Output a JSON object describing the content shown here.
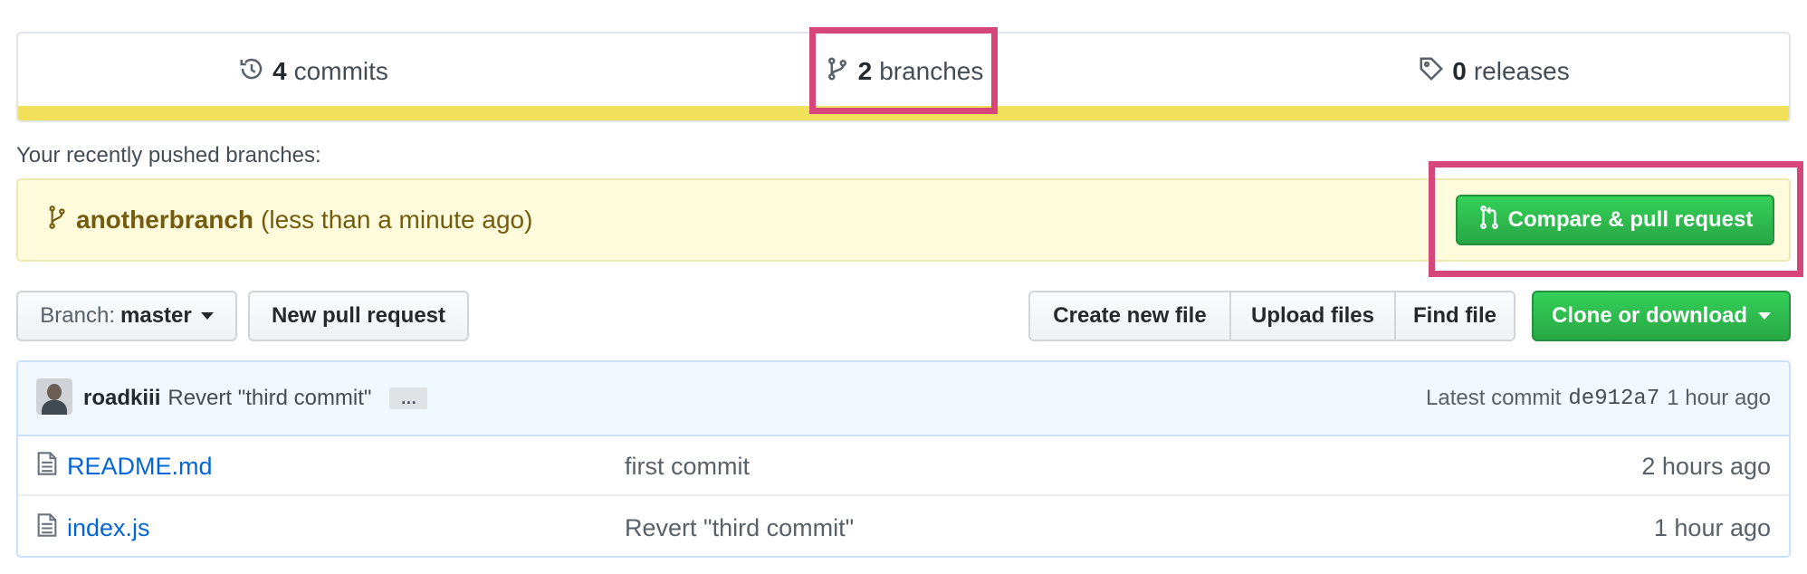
{
  "summary": {
    "commits": {
      "count": "4",
      "label": "commits",
      "icon": "history-icon"
    },
    "branches": {
      "count": "2",
      "label": "branches",
      "icon": "git-branch-icon"
    },
    "releases": {
      "count": "0",
      "label": "releases",
      "icon": "tag-icon"
    },
    "language_bar_color": "#f1e05a"
  },
  "recent_pushes": {
    "label": "Your recently pushed branches:",
    "branch_name": "anotherbranch",
    "time": "(less than a minute ago)",
    "compare_button": "Compare & pull request"
  },
  "toolbar": {
    "branch_prefix": "Branch:",
    "branch_name": "master",
    "new_pr": "New pull request",
    "create_file": "Create new file",
    "upload_files": "Upload files",
    "find_file": "Find file",
    "clone": "Clone or download"
  },
  "latest_commit": {
    "author": "roadkiii",
    "message": "Revert \"third commit\"",
    "ellipsis": "…",
    "label": "Latest commit",
    "sha": "de912a7",
    "age": "1 hour ago"
  },
  "files": [
    {
      "name": "README.md",
      "message": "first commit",
      "age": "2 hours ago"
    },
    {
      "name": "index.js",
      "message": "Revert \"third commit\"",
      "age": "1 hour ago"
    }
  ],
  "colors": {
    "highlight": "#d6467a",
    "green": "#28a745",
    "link": "#0366d6",
    "notice_bg": "#fffbdd"
  }
}
